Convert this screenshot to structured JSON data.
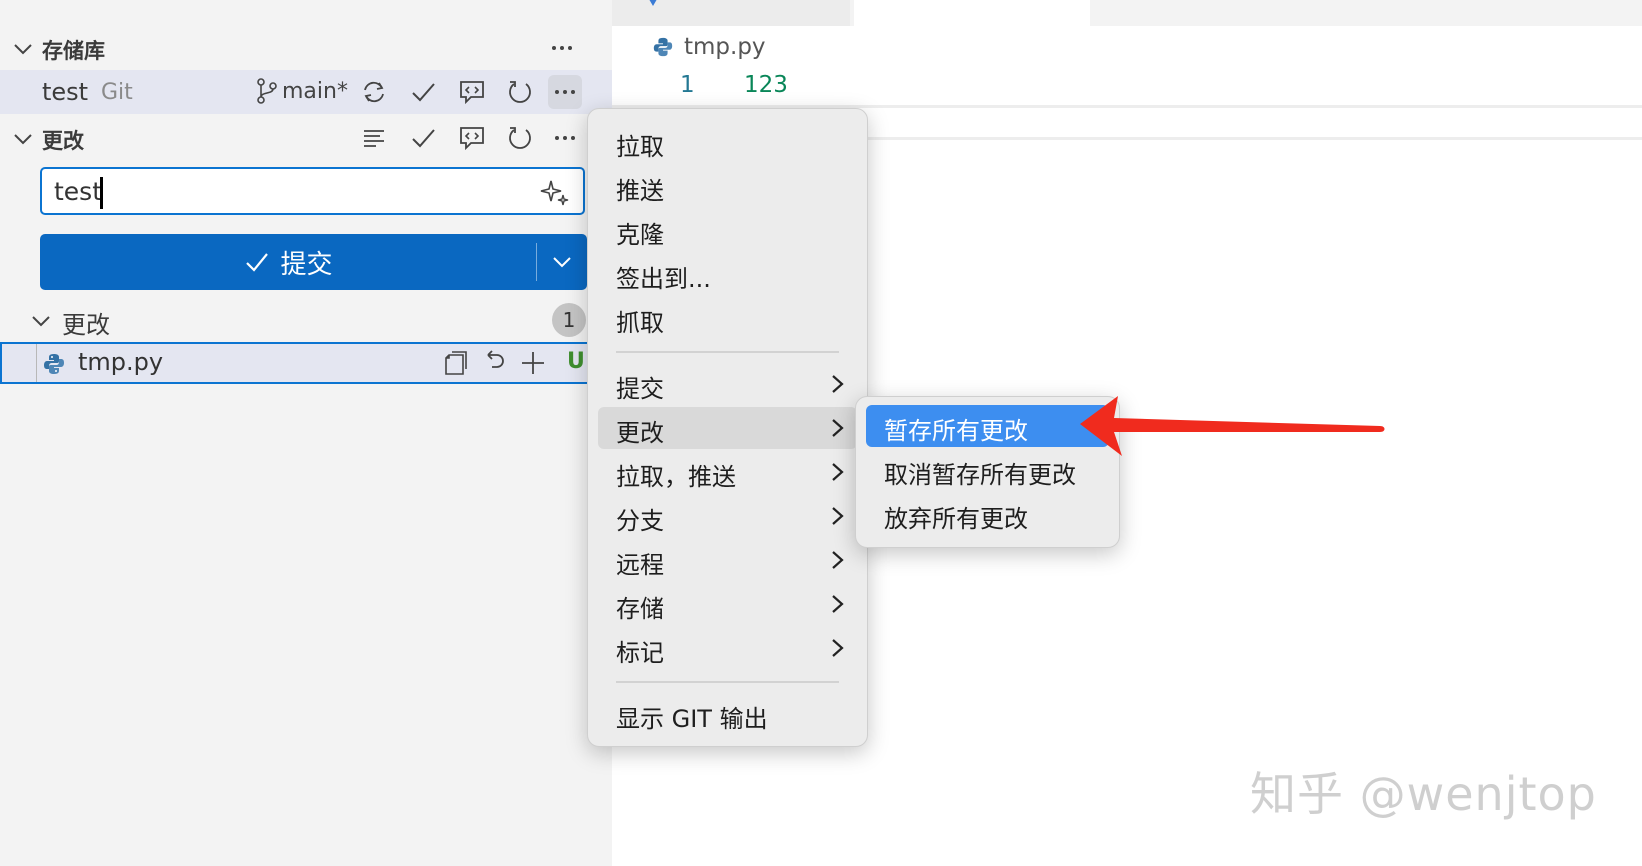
{
  "sidebar": {
    "repos_section_title": "存储库",
    "repo": {
      "name": "test",
      "kind": "Git",
      "branch": "main*"
    },
    "changes_section_title": "更改",
    "commit_message": "test",
    "commit_button_label": "提交",
    "changes_group_label": "更改",
    "changes_count": "1",
    "file": {
      "name": "tmp.py",
      "status": "U"
    }
  },
  "editor": {
    "breadcrumb_file": "tmp.py",
    "lines": [
      {
        "number": "1",
        "text": "123"
      }
    ]
  },
  "context_menu": {
    "items_top": [
      "拉取",
      "推送",
      "克隆",
      "签出到...",
      "抓取"
    ],
    "items_submenus": [
      "提交",
      "更改",
      "拉取，推送",
      "分支",
      "远程",
      "存储",
      "标记"
    ],
    "items_bottom": [
      "显示 GIT 输出"
    ],
    "hovered_item": "更改"
  },
  "submenu": {
    "items": [
      "暂存所有更改",
      "取消暂存所有更改",
      "放弃所有更改"
    ],
    "selected_item": "暂存所有更改"
  },
  "watermark": "知乎 @wenjtop",
  "colors": {
    "accent": "#0a68c1",
    "selection": "#3d8ef0",
    "annotation_arrow": "#f02b1e",
    "untracked": "#3f8f2f"
  }
}
